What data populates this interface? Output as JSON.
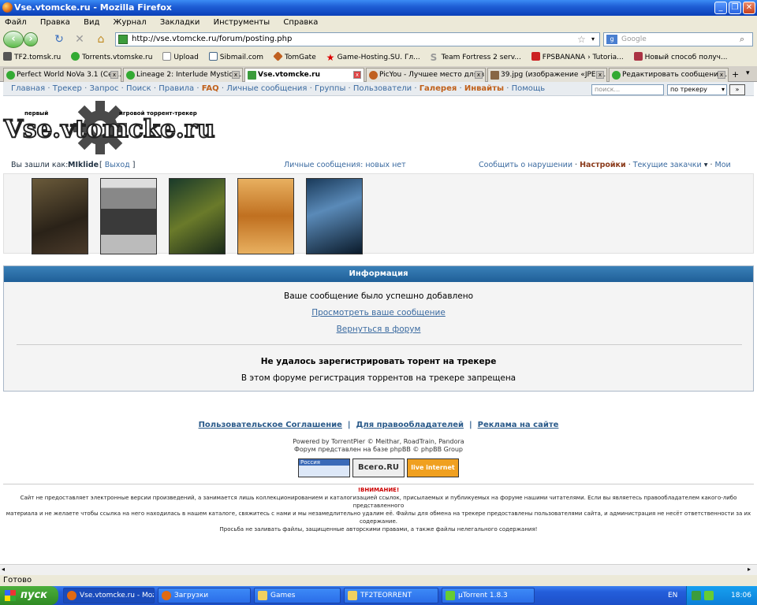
{
  "window": {
    "title": "Vse.vtomcke.ru - Mozilla Firefox"
  },
  "menu": [
    "Файл",
    "Правка",
    "Вид",
    "Журнал",
    "Закладки",
    "Инструменты",
    "Справка"
  ],
  "url": "http://vse.vtomcke.ru/forum/posting.php",
  "search_placeholder": "Google",
  "bookmarks": [
    "TF2.tomsk.ru",
    "Torrents.vtomske.ru",
    "Upload",
    "Sibmail.com",
    "TomGate",
    "Game-Hosting.SU. Гл...",
    "Team Fortress 2 serv...",
    "FPSBANANA › Tutoria...",
    "Новый способ получ..."
  ],
  "tabs": [
    "Perfect World NoVa 3.1 (Сер...",
    "Lineage 2: Interlude MysticW...",
    "Vse.vtomcke.ru",
    "PicYou - Лучшее место для в...",
    "39.jpg (изображение «JPEG...",
    "Редактировать сообщение ..."
  ],
  "sitenav": {
    "items": [
      "Главная",
      "Трекер",
      "Запрос",
      "Поиск",
      "Правила",
      "FAQ",
      "Личные сообщения",
      "Группы",
      "Пользователи",
      "Галерея",
      "Инвайты",
      "Помощь"
    ],
    "search_placeholder": "поиск...",
    "scope": "по трекеру",
    "go": "»"
  },
  "logo": {
    "text": "Vse.vtomcke.ru",
    "tag_left": "первый",
    "tag_right": "игровой торрент-трекер"
  },
  "userbar": {
    "logged_as": "Вы зашли как:",
    "username": "MIklide",
    "logout": "Выход",
    "pm": "Личные сообщения: новых нет",
    "report": "Сообщить о нарушении",
    "settings": "Настройки",
    "downloads": "Текущие закачки",
    "my_posts": "Мои сообщения"
  },
  "info": {
    "header": "Информация",
    "msg1": "Ваше сообщение было успешно добавлено",
    "link1": "Просмотреть ваше сообщение",
    "link2": "Вернуться в форум",
    "err_title": "Не удалось зарегистрировать торент на трекере",
    "err_text": "В этом форуме регистрация торрентов на трекере запрещена"
  },
  "footer": {
    "links": [
      "Пользовательское Соглашение",
      "Для правообладателей",
      "Реклама на сайте"
    ],
    "powered": "Powered by TorrentPier © Meithar, RoadTrain, Pandora",
    "forum_base": "Форум представлен на базе phpBB © phpBB Group",
    "counters": [
      "Россия",
      "Всего.RU",
      "live internet"
    ],
    "warn": "!ВНИМАНИЕ!",
    "disclaimer1": "Сайт не предоставляет электронные версии произведений, а занимается лишь коллекционированием и каталогизацией ссылок, присылаемых и публикуемых на форуме нашими читателями. Если вы являетесь правообладателем какого-либо представленного",
    "disclaimer2": "материала и не желаете чтобы ссылка на него находилась в нашем каталоге, свяжитесь с нами и мы незамедлительно удалим её. Файлы для обмена на трекере предоставлены пользователями сайта, и администрация не несёт ответственности за их содержание.",
    "disclaimer3": "Просьба не заливать файлы, защищенные авторскими правами, а также файлы нелегального содержания!"
  },
  "status": "Готово",
  "taskbar": {
    "start": "пуск",
    "tasks": [
      "Vse.vtomcke.ru - Moz...",
      "Загрузки",
      "Games",
      "TF2TEORRENT",
      "µTorrent 1.8.3"
    ],
    "lang": "EN",
    "time": "18:06"
  }
}
